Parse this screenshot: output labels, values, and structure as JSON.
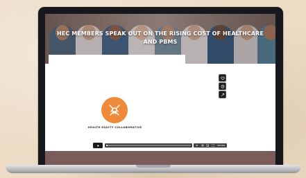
{
  "page": {
    "hero_title": "HEC MEMBERS SPEAK OUT ON THE RISING COST OF HEALTHCARE AND PBMS"
  },
  "video": {
    "logo_text": "HEALTH EQUITY COLLABORATIVE",
    "progress_fraction": 0.0,
    "controls": {
      "icons": [
        "play-icon",
        "volume-icon",
        "settings-icon",
        "pip-icon",
        "fullscreen-icon"
      ],
      "brand": "vimeo"
    },
    "side_actions": [
      "heart-icon",
      "clock-icon",
      "share-icon"
    ]
  },
  "colors": {
    "accent_orange": "#ef8a3b",
    "footer": "#7a5c5a",
    "hero_tint": "#6e5c55"
  }
}
